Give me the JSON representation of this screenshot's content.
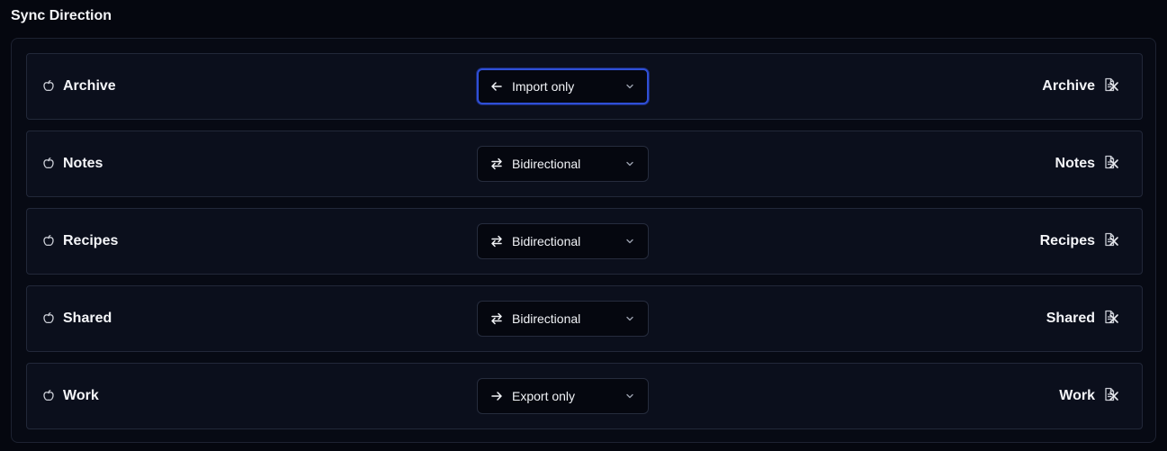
{
  "section": {
    "title": "Sync Direction"
  },
  "rows": [
    {
      "folder": "Archive",
      "mode": "Import only",
      "mode_icon": "arrow-left-icon",
      "target": "Archive"
    },
    {
      "folder": "Notes",
      "mode": "Bidirectional",
      "mode_icon": "bidirectional-arrows-icon",
      "target": "Notes"
    },
    {
      "folder": "Recipes",
      "mode": "Bidirectional",
      "mode_icon": "bidirectional-arrows-icon",
      "target": "Recipes"
    },
    {
      "folder": "Shared",
      "mode": "Bidirectional",
      "mode_icon": "bidirectional-arrows-icon",
      "target": "Shared"
    },
    {
      "folder": "Work",
      "mode": "Export only",
      "mode_icon": "arrow-right-icon",
      "target": "Work"
    }
  ],
  "colors": {
    "focus_ring": "#2f4fd6",
    "background": "#05070f",
    "row_bg": "#0b0f1c"
  }
}
